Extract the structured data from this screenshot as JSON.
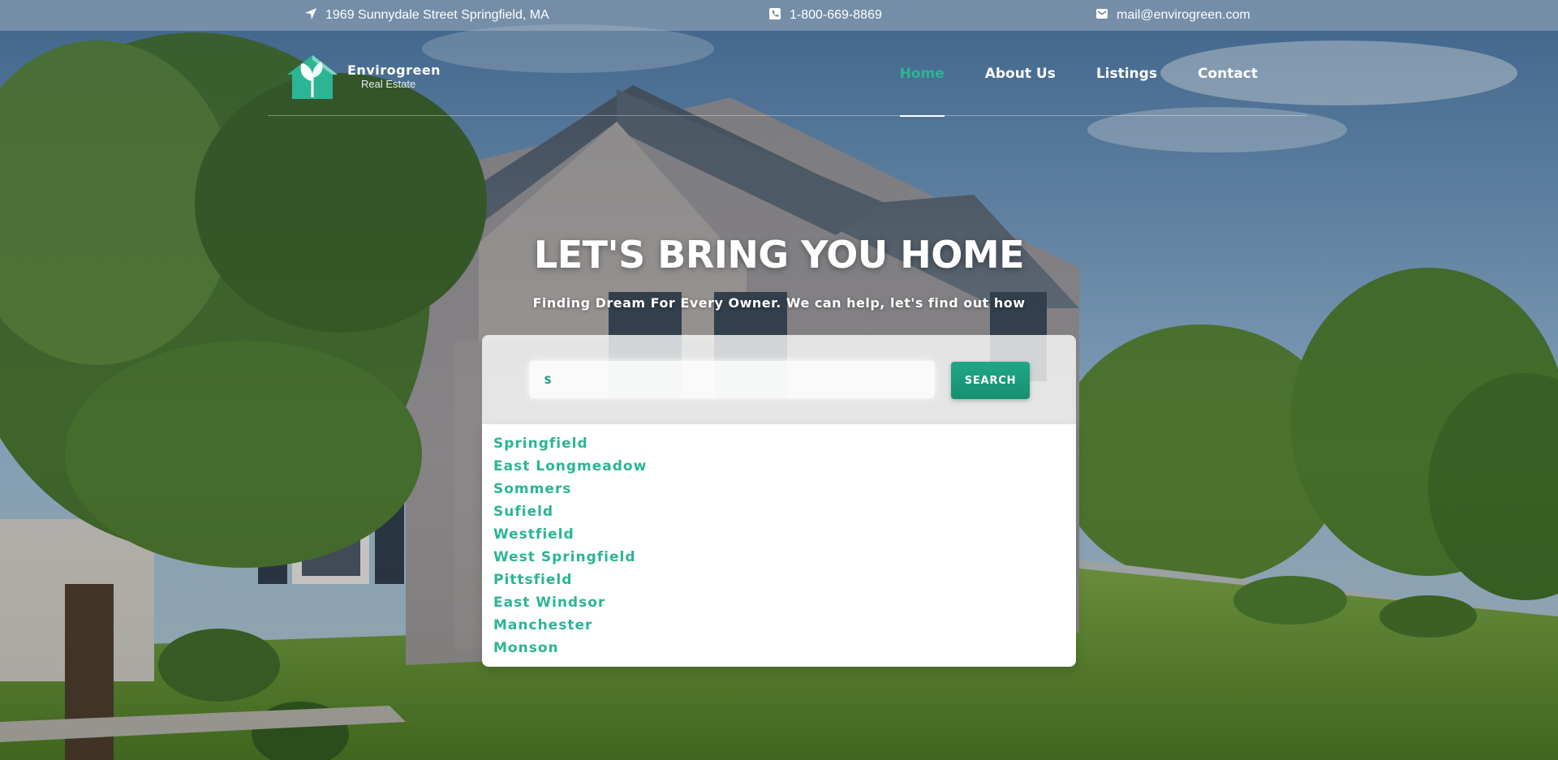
{
  "topbar": {
    "address": "1969 Sunnydale Street Springfield, MA",
    "phone": "1-800-669-8869",
    "email": "mail@envirogreen.com"
  },
  "logo": {
    "name": "Envirogreen",
    "tagline": "Real Estate"
  },
  "nav": {
    "items": [
      {
        "label": "Home",
        "active": true
      },
      {
        "label": "About Us",
        "active": false
      },
      {
        "label": "Listings",
        "active": false
      },
      {
        "label": "Contact",
        "active": false
      }
    ]
  },
  "hero": {
    "title": "LET'S BRING YOU HOME",
    "subtitle": "Finding Dream For Every Owner. We can help, let's find out how"
  },
  "search": {
    "value": "s",
    "button_label": "SEARCH"
  },
  "suggestions": [
    "Springfield",
    "East Longmeadow",
    "Sommers",
    "Sufield",
    "Westfield",
    "West Springfield",
    "Pittsfield",
    "East Windsor",
    "Manchester",
    "Monson"
  ],
  "colors": {
    "accent": "#2bb594",
    "button": "#1a9c7c"
  },
  "icons": {
    "address": "location-arrow-icon",
    "phone": "phone-icon",
    "email": "envelope-icon"
  }
}
